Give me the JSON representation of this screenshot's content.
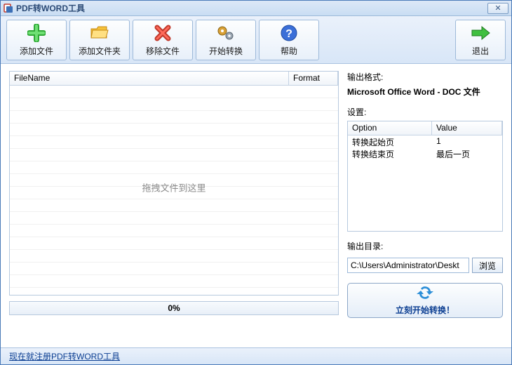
{
  "window": {
    "title": "PDF转WORD工具"
  },
  "toolbar": {
    "addFile": "添加文件",
    "addFolder": "添加文件夹",
    "remove": "移除文件",
    "start": "开始转换",
    "help": "帮助",
    "exit": "退出"
  },
  "fileTable": {
    "col_filename": "FileName",
    "col_format": "Format",
    "placeholder": "拖拽文件到这里"
  },
  "progress": {
    "text": "0%"
  },
  "output": {
    "formatLabel": "输出格式:",
    "formatValue": "Microsoft Office Word - DOC 文件",
    "settingsLabel": "设置:",
    "optionsHeader": {
      "option": "Option",
      "value": "Value"
    },
    "options": [
      {
        "name": "转换起始页",
        "value": "1"
      },
      {
        "name": "转换结束页",
        "value": "最后一页"
      }
    ],
    "dirLabel": "输出目录:",
    "dirValue": "C:\\Users\\Administrator\\Deskt",
    "browse": "浏览"
  },
  "convert": {
    "label": "立刻开始转换！"
  },
  "footer": {
    "register": "现在就注册PDF转WORD工具"
  }
}
